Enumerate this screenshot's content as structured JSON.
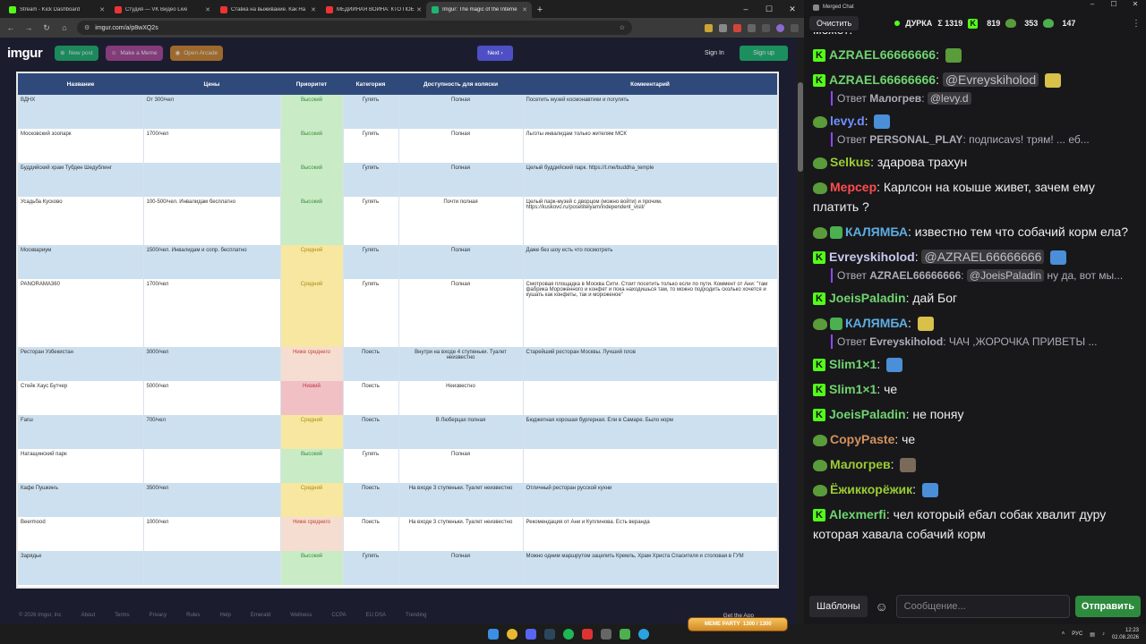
{
  "browser": {
    "tabs": [
      {
        "title": "Stream - Kick Dashboard",
        "color": "#53fc18"
      },
      {
        "title": "Студия — VK Видео Live",
        "color": "#e33"
      },
      {
        "title": "Ставка на выживание. Как На",
        "color": "#e33"
      },
      {
        "title": "МЕДИЙНАЯ ВОЙНА: КТО ПОЕ",
        "color": "#e33"
      },
      {
        "title": "Imgur: The magic of the Interne",
        "color": "#1bb76e"
      }
    ],
    "url": "imgur.com/a/p8wXQ2s"
  },
  "imgur": {
    "logo": "imgur",
    "new_post": "New post",
    "make_meme": "Make a Meme",
    "open_arcade": "Open Arcade",
    "next": "Next",
    "sign_in": "Sign In",
    "sign_up": "Sign up"
  },
  "table": {
    "headers": [
      "Название",
      "Цены",
      "Приоритет",
      "Категория",
      "Доступность для коляски",
      "Комментарий"
    ],
    "rows": [
      {
        "name": "ВДНХ",
        "price": "От 300/чел",
        "priority": "Высокий",
        "level": "high",
        "category": "Гулять",
        "access": "Полная",
        "comment": "Посетить музей космонавтики и погулять",
        "h": 38
      },
      {
        "name": "Московский зоопарк",
        "price": "1700/чел",
        "priority": "Высокий",
        "level": "high",
        "category": "Гулять",
        "access": "Полная",
        "comment": "Льготы инвалидам только жителям МСК",
        "h": 38
      },
      {
        "name": "Буддийский храм Тубден Шедублинг",
        "price": "",
        "priority": "Высокий",
        "level": "high",
        "category": "Гулять",
        "access": "Полная",
        "comment": "Целый буддийский парк. https://t.me/buddha_temple",
        "h": 38
      },
      {
        "name": "Усадьба Кусково",
        "price": "100-500/чел. Инвалидам бесплатно",
        "priority": "Высокий",
        "level": "high",
        "category": "Гулять",
        "access": "Почти полная",
        "comment": "Целый парк-музей с дворцом (можно войти) и прочим. https://kuskovo.ru/posetitelyam/independent_visit/",
        "h": 54
      },
      {
        "name": "Москвариум",
        "price": "1500/чел. Инвалидам и сопр. бесплатно",
        "priority": "Средний",
        "level": "mid",
        "category": "Гулять",
        "access": "Полная",
        "comment": "Даже без шоу есть что посмотреть",
        "h": 38
      },
      {
        "name": "PANORAMA360",
        "price": "1700/чел",
        "priority": "Средний",
        "level": "mid",
        "category": "Гулять",
        "access": "Полная",
        "comment": "Смотровая площадка в Москва Сити. Стоит посетить только если по пути. Коммент от Ани: \"там фабрика Мороженного и конфет и пока находишься там, то можно подходить сколько хочется и кушать как конфеты, так и мороженое\"",
        "h": 76
      },
      {
        "name": "Ресторан Узбекистан",
        "price": "3000/чел",
        "priority": "Ниже среднего",
        "level": "below",
        "category": "Поесть",
        "access": "Внутри на входе 4 ступеньки. Туалет неизвестно",
        "comment": "Старейший ресторан Москвы. Лучший плов",
        "h": 38
      },
      {
        "name": "Стейк Хаус Бутчер",
        "price": "5000/чел",
        "priority": "Низкий",
        "level": "low",
        "category": "Поесть",
        "access": "Неизвестно",
        "comment": "",
        "h": 38
      },
      {
        "name": "Fаrш",
        "price": "700/чел",
        "priority": "Средний",
        "level": "mid",
        "category": "Поесть",
        "access": "В Люберцах полная",
        "comment": "Бюджетная хорошая бургерная. Ели в Самаре. Было норм",
        "h": 38
      },
      {
        "name": "Натащинский парк",
        "price": "",
        "priority": "Высокий",
        "level": "high",
        "category": "Гулять",
        "access": "Полная",
        "comment": "",
        "h": 38
      },
      {
        "name": "Кафе Пушкинъ",
        "price": "3500/чел",
        "priority": "Средний",
        "level": "mid",
        "category": "Поесть",
        "access": "На входе 3 ступеньки. Туалет неизвестно",
        "comment": "Отличный ресторан русской кухни",
        "h": 38
      },
      {
        "name": "Beermood",
        "price": "1000/чел",
        "priority": "Ниже среднего",
        "level": "below",
        "category": "Поесть",
        "access": "На входе 3 ступеньки. Туалет неизвестно",
        "comment": "Рекомендация от Ани и Куплинова. Есть веранда",
        "h": 38
      },
      {
        "name": "Зарядье",
        "price": "",
        "priority": "Высокий",
        "level": "high",
        "category": "Гулять",
        "access": "Полная",
        "comment": "Можно одним маршрутом зацепить Кремль, Храм Христа Спасителя и столовая в ГУМ",
        "h": 38
      }
    ]
  },
  "footer": {
    "links": [
      "© 2026 Imgur, Inc",
      "About",
      "Terms",
      "Privacy",
      "Rules",
      "Help",
      "Emerald",
      "Wellness",
      "CCPA",
      "EU DSA",
      "Trending"
    ],
    "get_app": "Get the App"
  },
  "taskbar": {
    "lang": "РУС",
    "time": "12:23",
    "date": "02.08.2026",
    "meme_party": "MEME PARTY",
    "meme_counter": "1300 / 1300"
  },
  "chat": {
    "window_title": "Merged Chat",
    "clear": "Очистить",
    "channel": "ДУРКА",
    "total": "Σ 1319",
    "kick_count": "819",
    "twitch_count": "353",
    "other_count": "147",
    "partial_top": "может:",
    "messages": [
      {
        "user": "AZRAEL66666666",
        "color": "#6fd46f",
        "badge": "kick",
        "text": "",
        "emote": true
      },
      {
        "user": "AZRAEL66666666",
        "color": "#6fd46f",
        "badge": "kick",
        "mention": "@Evreyskiholod",
        "text": "",
        "emote": true
      },
      {
        "reply_user": "Малогрев",
        "reply_mention": "@levy.d",
        "reply_text": ""
      },
      {
        "user": "levy.d",
        "color": "#6f8fff",
        "badge": "pepe",
        "text": "",
        "emote": true
      },
      {
        "reply_user": "PERSONAL_PLAY",
        "reply_text": "подписаvs! трям! ... еб..."
      },
      {
        "user": "Selkus",
        "color": "#9acd32",
        "badge": "pepe",
        "text": "здарова трахун"
      },
      {
        "user": "Мерсер",
        "color": "#ff4d4d",
        "badge": "pepe",
        "text": "Карлсон на коыше живет, зачем ему платить ?"
      },
      {
        "user": "КАЛЯМБА",
        "color": "#5dade2",
        "badge": "pepe-shield",
        "text": "известно тем что собачий корм ела?"
      },
      {
        "user": "Evreyskiholod",
        "color": "#c8c8f0",
        "badge": "kick",
        "mention": "@AZRAEL66666666",
        "text": "",
        "emote": true
      },
      {
        "reply_user": "AZRAEL66666666",
        "reply_mention": "@JoeisPaladin",
        "reply_text": "ну да, вот мы..."
      },
      {
        "user": "JoeisPaladin",
        "color": "#6fd46f",
        "badge": "kick",
        "text": "дай Бог"
      },
      {
        "user": "КАЛЯМБА",
        "color": "#5dade2",
        "badge": "pepe-shield",
        "text": "",
        "emote": true
      },
      {
        "reply_user": "Evreyskiholod",
        "reply_text": "ЧАЧ ,ЖОРОЧКА ПРИВЕТЫ ..."
      },
      {
        "user": "Slim1×1",
        "color": "#6fd46f",
        "badge": "kick",
        "text": "",
        "emote": true
      },
      {
        "user": "Slim1×1",
        "color": "#6fd46f",
        "badge": "kick",
        "text": "че"
      },
      {
        "user": "JoeisPaladin",
        "color": "#6fd46f",
        "badge": "kick",
        "text": "не поняу"
      },
      {
        "user": "CopyPaste",
        "color": "#d2915c",
        "badge": "pepe",
        "text": "че"
      },
      {
        "user": "Малогрев",
        "color": "#9acd32",
        "badge": "pepe",
        "text": "",
        "emote": true
      },
      {
        "user": "Ёжиккорёжик",
        "color": "#9acd32",
        "badge": "pepe",
        "text": "",
        "emote": true
      },
      {
        "user": "Alexmerfi",
        "color": "#6fd46f",
        "badge": "kick",
        "text": "чел который ебал собак хвалит дуру которая хавала собачий корм"
      }
    ],
    "templates": "Шаблоны",
    "input_placeholder": "Сообщение...",
    "send": "Отправить"
  },
  "colors": {
    "header_blue": "#2f4a7a",
    "row_blue": "#cde0ef",
    "high": "#c9ecc6",
    "mid": "#f7e7a0",
    "below": "#f6ddd2",
    "low": "#f0c0c5",
    "kick_green": "#53fc18"
  }
}
